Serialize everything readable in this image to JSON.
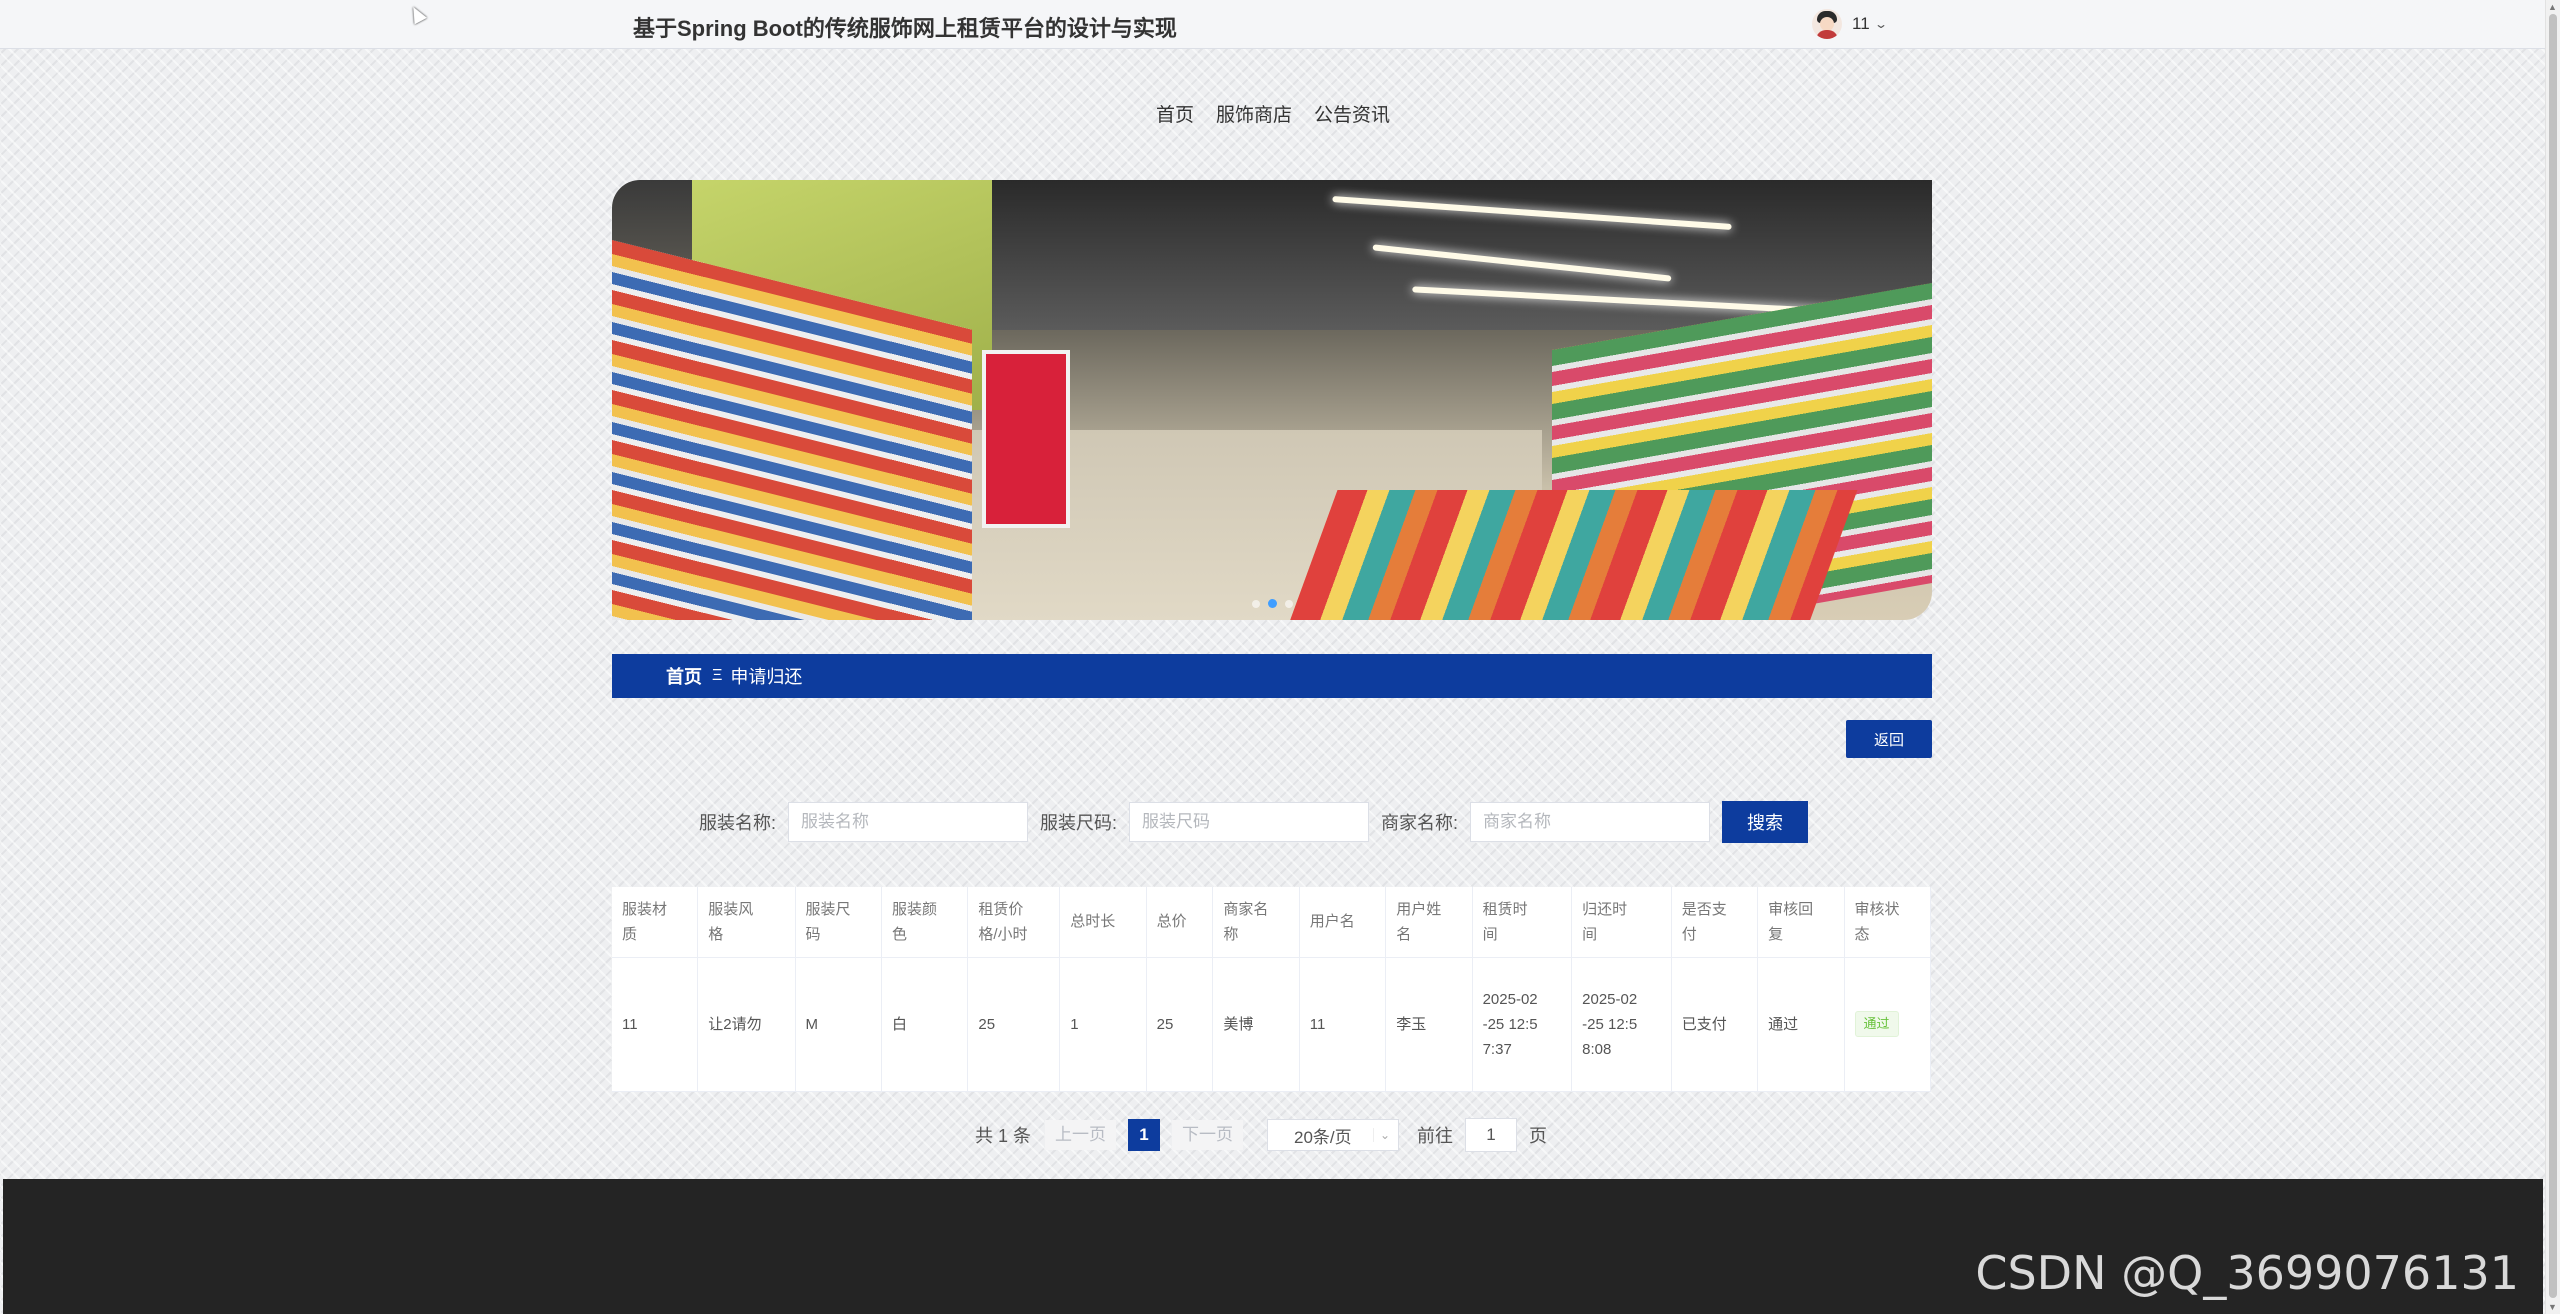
{
  "header": {
    "site_title": "基于Spring Boot的传统服饰网上租赁平台的设计与实现",
    "username": "11"
  },
  "nav": [
    {
      "label": "首页"
    },
    {
      "label": "服饰商店"
    },
    {
      "label": "公告资讯"
    }
  ],
  "carousel": {
    "slide_count": 3,
    "active_index": 1
  },
  "breadcrumb": {
    "home": "首页",
    "separator": "Ξ",
    "current": "申请归还"
  },
  "back_button": "返回",
  "search": {
    "fields": [
      {
        "label": "服装名称:",
        "placeholder": "服装名称"
      },
      {
        "label": "服装尺码:",
        "placeholder": "服装尺码"
      },
      {
        "label": "商家名称:",
        "placeholder": "商家名称"
      }
    ],
    "button": "搜索"
  },
  "table": {
    "columns": [
      [
        "服装材",
        "质"
      ],
      [
        "服装风",
        "格"
      ],
      [
        "服装尺",
        "码"
      ],
      [
        "服装颜",
        "色"
      ],
      [
        "租赁价",
        "格/小时"
      ],
      [
        "总时长"
      ],
      [
        "总价"
      ],
      [
        "商家名",
        "称"
      ],
      [
        "用户名"
      ],
      [
        "用户姓",
        "名"
      ],
      [
        "租赁时",
        "间"
      ],
      [
        "归还时",
        "间"
      ],
      [
        "是否支",
        "付"
      ],
      [
        "审核回",
        "复"
      ],
      [
        "审核状",
        "态"
      ]
    ],
    "rows": [
      [
        [
          "11"
        ],
        [
          "让2请勿"
        ],
        [
          "M"
        ],
        [
          "白"
        ],
        [
          "25"
        ],
        [
          "1"
        ],
        [
          "25"
        ],
        [
          "美博"
        ],
        [
          "11"
        ],
        [
          "李玉"
        ],
        [
          "2025-02",
          "-25 12:5",
          "7:37"
        ],
        [
          "2025-02",
          "-25 12:5",
          "8:08"
        ],
        [
          "已支付"
        ],
        [
          "通过"
        ],
        [
          "通过"
        ]
      ]
    ],
    "status_badge_color": "#67c23a"
  },
  "pagination": {
    "total": "共 1 条",
    "prev": "上一页",
    "current_page": "1",
    "next": "下一页",
    "page_size": "20条/页",
    "goto_label": "前往",
    "goto_value": "1",
    "page_unit": "页"
  },
  "footer": {
    "watermark": "CSDN @Q_3699076131"
  },
  "colors": {
    "primary": "#0d3c9e",
    "footer": "#242424",
    "success": "#67c23a"
  }
}
